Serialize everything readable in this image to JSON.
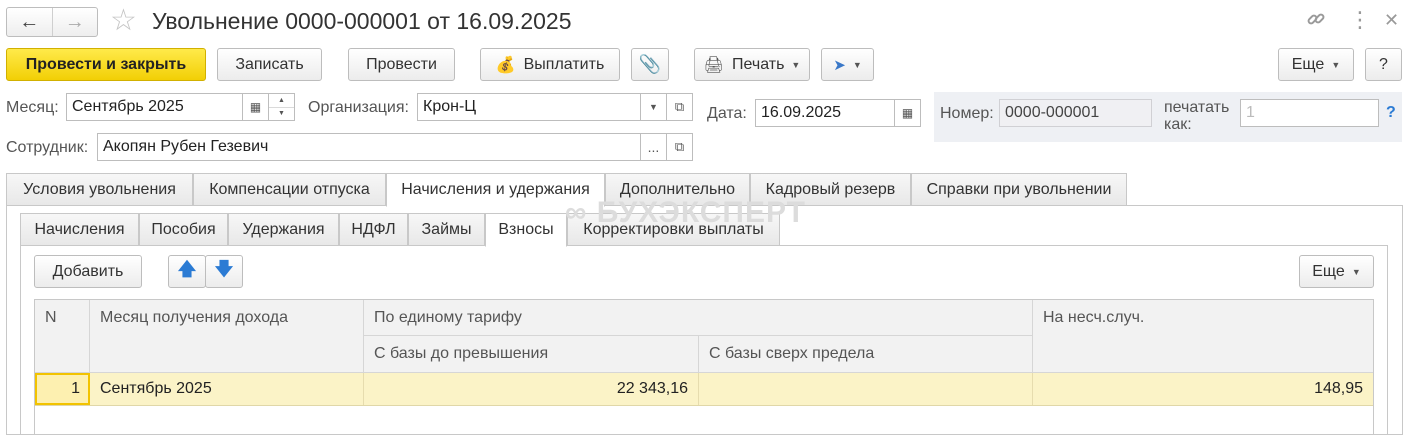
{
  "window": {
    "title": "Увольнение 0000-000001 от 16.09.2025",
    "icons": [
      "arrow-left-icon",
      "arrow-right-icon",
      "star-icon",
      "link-icon",
      "more-vertical-icon",
      "close-icon"
    ]
  },
  "toolbar": {
    "post_close": "Провести и закрыть",
    "save": "Записать",
    "post": "Провести",
    "pay": "Выплатить",
    "print": "Печать",
    "more": "Еще",
    "help": "?"
  },
  "form": {
    "month_label": "Месяц:",
    "month_value": "Сентябрь 2025",
    "org_label": "Организация:",
    "org_value": "Крон-Ц",
    "date_label": "Дата:",
    "date_value": "16.09.2025",
    "number_label": "Номер:",
    "number_value": "0000-000001",
    "print_as_label_1": "печатать",
    "print_as_label_2": "как:",
    "print_as_value": "1",
    "help": "?",
    "employee_label": "Сотрудник:",
    "employee_value": "Акопян Рубен Гезевич",
    "choose": "..."
  },
  "tabs": [
    {
      "label": "Условия увольнения"
    },
    {
      "label": "Компенсации отпуска"
    },
    {
      "label": "Начисления и удержания",
      "active": true
    },
    {
      "label": "Дополнительно"
    },
    {
      "label": "Кадровый резерв"
    },
    {
      "label": "Справки при увольнении"
    }
  ],
  "subtabs": [
    {
      "label": "Начисления"
    },
    {
      "label": "Пособия"
    },
    {
      "label": "Удержания"
    },
    {
      "label": "НДФЛ"
    },
    {
      "label": "Займы"
    },
    {
      "label": "Взносы",
      "active": true
    },
    {
      "label": "Корректировки выплаты"
    }
  ],
  "watermark": "БУХЭКСПЕРТ",
  "table_toolbar": {
    "add": "Добавить",
    "more": "Еще"
  },
  "table": {
    "headers": {
      "n": "N",
      "month": "Месяц получения дохода",
      "single_rate": "По единому тарифу",
      "base_below": "С базы до превышения",
      "base_above": "С базы сверх предела",
      "accident": "На несч.случ."
    },
    "rows": [
      {
        "n": "1",
        "month": "Сентябрь 2025",
        "base_below": "22 343,16",
        "base_above": "",
        "accident": "148,95"
      }
    ]
  }
}
